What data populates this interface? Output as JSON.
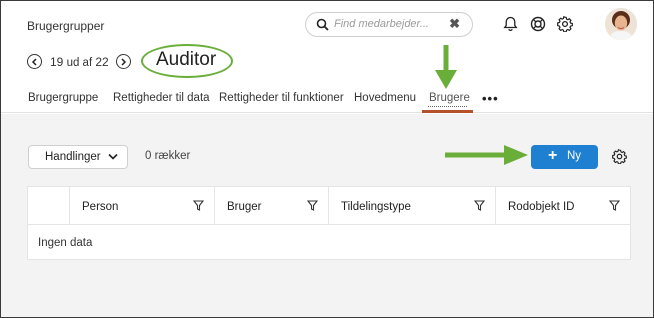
{
  "header": {
    "breadcrumb": "Brugergrupper",
    "search": {
      "placeholder": "Find medarbejder..."
    },
    "icons": [
      "bell-icon",
      "help-lifebuoy-icon",
      "gear-icon"
    ]
  },
  "pager": {
    "current": "19",
    "of_text": "ud af",
    "total": "22"
  },
  "page_title": "Auditor",
  "tabs": [
    {
      "label": "Brugergruppe"
    },
    {
      "label": "Rettigheder til data"
    },
    {
      "label": "Rettigheder til funktioner"
    },
    {
      "label": "Hovedmenu"
    },
    {
      "label": "Brugere"
    }
  ],
  "active_tab": "Brugere",
  "toolbar": {
    "actions_label": "Handlinger",
    "row_count": "0 rækker",
    "new_label": "Ny"
  },
  "table": {
    "columns": [
      "Person",
      "Bruger",
      "Tildelingstype",
      "Rodobjekt ID"
    ],
    "empty_text": "Ingen data"
  },
  "colors": {
    "accent": "#1f7fd1",
    "annotation": "#6aae3a",
    "tab_underline": "#b5522b"
  }
}
